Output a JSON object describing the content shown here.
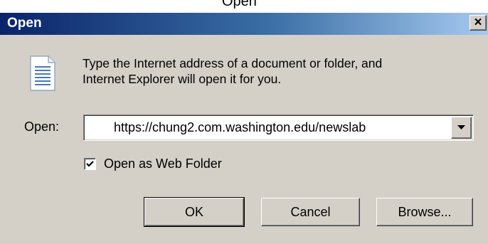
{
  "title_strip": {
    "text": "Open"
  },
  "dialog": {
    "title": "Open",
    "close_label": "×",
    "message": "Type the Internet address of a document or folder, and\nInternet Explorer will open it for you.",
    "open_label": "Open:",
    "address_value": "https://chung2.com.washington.edu/newslab",
    "web_folder_label": "Open as Web Folder",
    "web_folder_checked": true,
    "buttons": {
      "ok": "OK",
      "cancel": "Cancel",
      "browse": "Browse..."
    }
  },
  "colors": {
    "titlebar_start": "#0a246a",
    "titlebar_end": "#a6caf0",
    "dialog_face": "#d4d0c8"
  },
  "icons": {
    "document": "document-icon",
    "dropdown": "chevron-down-icon",
    "check": "checkmark-icon"
  }
}
